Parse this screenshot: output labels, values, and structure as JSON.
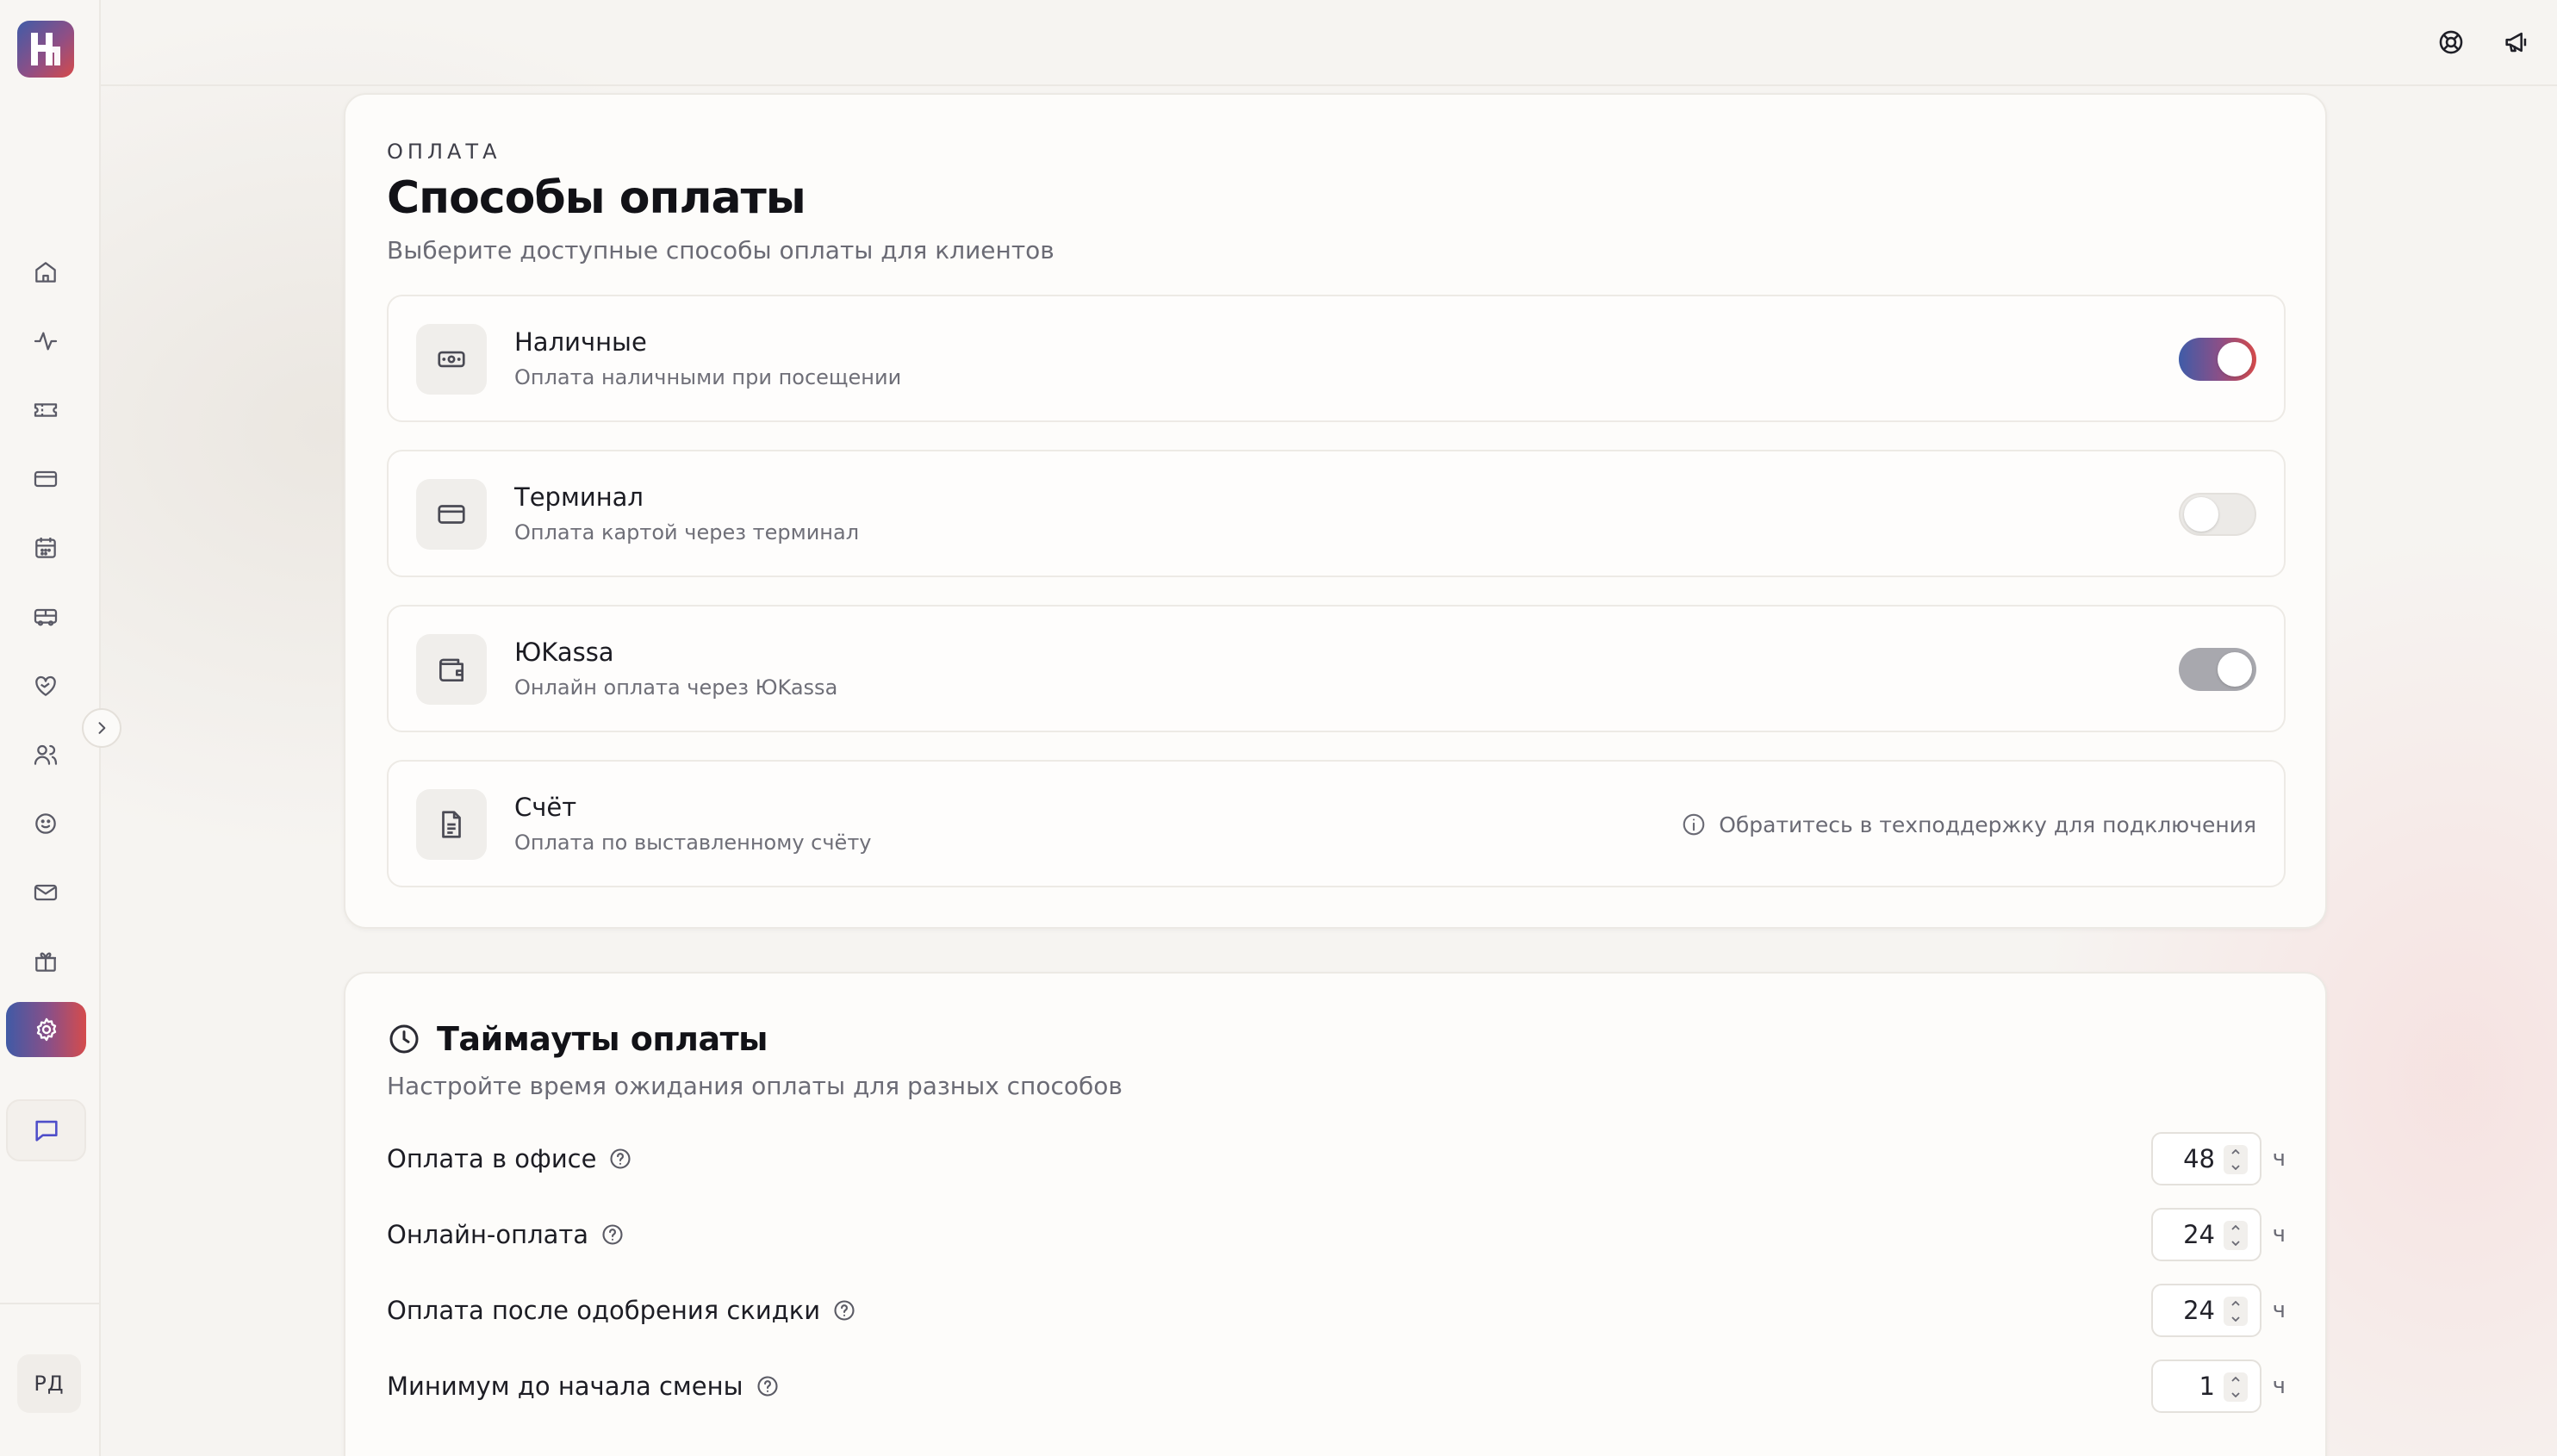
{
  "sidebar": {
    "avatar_initials": "РД",
    "nav": [
      "home-icon",
      "activity-icon",
      "ticket-icon",
      "card-icon",
      "calendar-icon",
      "bus-icon",
      "heart-handshake-icon",
      "users-icon",
      "smile-icon",
      "mail-icon",
      "gift-icon"
    ],
    "active": "settings-icon"
  },
  "payment": {
    "eyebrow": "ОПЛАТА",
    "title": "Способы оплаты",
    "subtitle": "Выберите доступные способы оплаты для клиентов",
    "methods": [
      {
        "name": "Наличные",
        "desc": "Оплата наличными при посещении",
        "icon": "cash-icon",
        "state": "on"
      },
      {
        "name": "Терминал",
        "desc": "Оплата картой через терминал",
        "icon": "card-icon",
        "state": "off"
      },
      {
        "name": "ЮKassa",
        "desc": "Онлайн оплата через ЮKassa",
        "icon": "wallet-icon",
        "state": "disabled-on"
      },
      {
        "name": "Счёт",
        "desc": "Оплата по выставленному счёту",
        "icon": "document-icon",
        "note": "Обратитесь в техподдержку для подключения"
      }
    ]
  },
  "timeouts": {
    "title": "Таймауты оплаты",
    "subtitle": "Настройте время ожидания оплаты для разных способов",
    "unit": "ч",
    "rows": [
      {
        "label": "Оплата в офисе",
        "value": "48"
      },
      {
        "label": "Онлайн-оплата",
        "value": "24"
      },
      {
        "label": "Оплата после одобрения скидки",
        "value": "24"
      },
      {
        "label": "Минимум до начала смены",
        "value": "1"
      }
    ]
  },
  "colors": {
    "accent_start": "#3f5ca8",
    "accent_mid": "#8e4f86",
    "accent_end": "#d64a4a",
    "chat_icon": "#4e4ec9"
  }
}
